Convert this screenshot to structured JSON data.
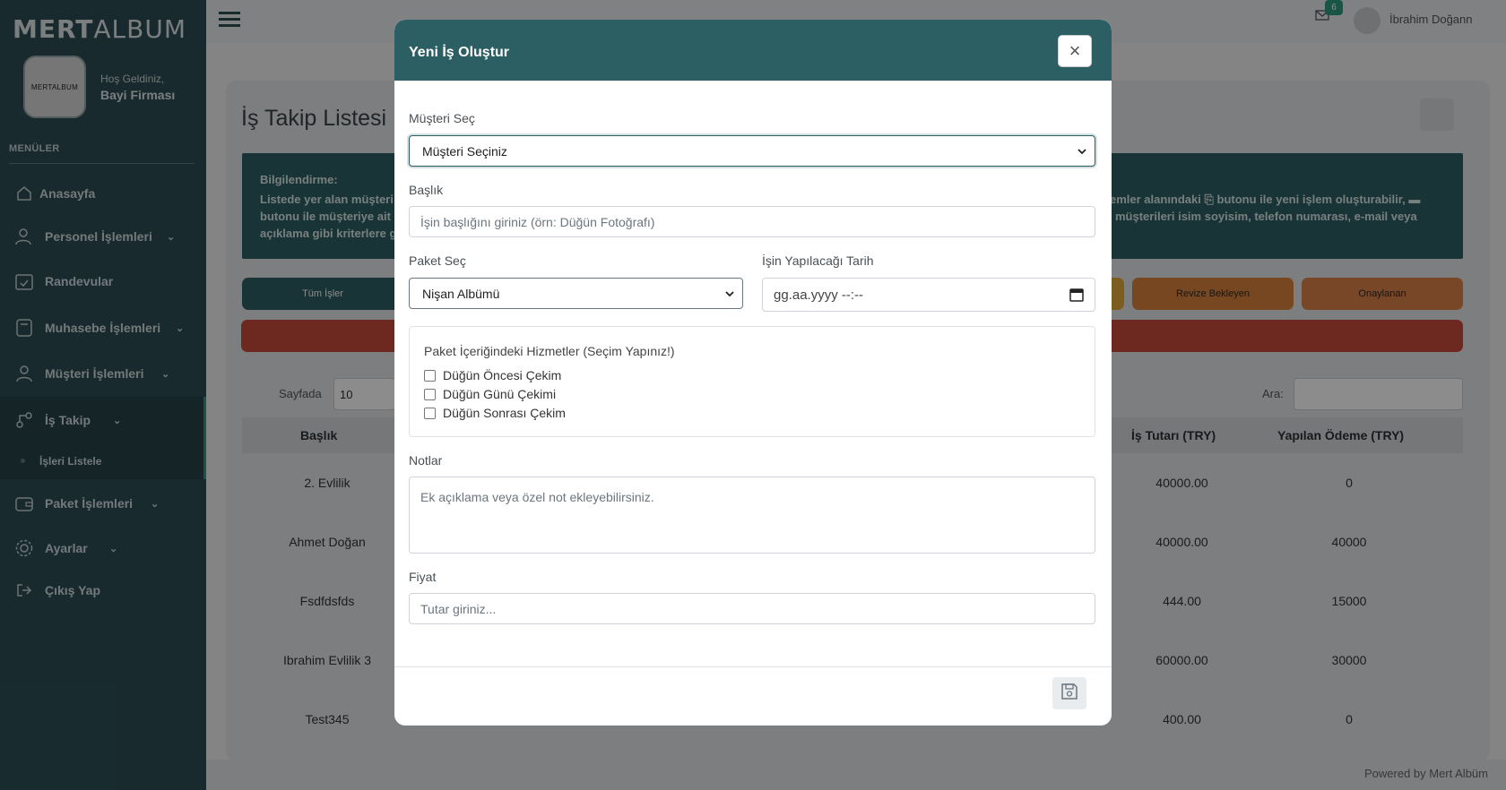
{
  "sidebar": {
    "logo_bold": "MERT",
    "logo_light": "ALBUM",
    "avatar_logo": "MERTALBUM",
    "welcome": "Hoş Geldiniz,",
    "firm": "Bayi Firması",
    "menus_title": "MENÜLER",
    "items": [
      {
        "label": "Anasayfa",
        "icon": "home-icon"
      },
      {
        "label": "Personel İşlemleri",
        "icon": "user-gear-icon"
      },
      {
        "label": "Randevular",
        "icon": "calendar-check-icon"
      },
      {
        "label": "Muhasebe İşlemleri",
        "icon": "calculator-icon"
      },
      {
        "label": "Müşteri İşlemleri",
        "icon": "user-icon"
      },
      {
        "label": "İş Takip",
        "icon": "tracking-icon"
      },
      {
        "label": "İşleri Listele",
        "icon": "dot-icon"
      },
      {
        "label": "Paket İşlemleri",
        "icon": "wallet-icon"
      },
      {
        "label": "Ayarlar",
        "icon": "gear-icon"
      },
      {
        "label": "Çıkış Yap",
        "icon": "logout-icon"
      }
    ]
  },
  "topbar": {
    "mail_badge": "6",
    "user_name": "İbrahim Doğann"
  },
  "page": {
    "title": "İş Takip Listesi",
    "info_title": "Bilgilendirme:",
    "info_left_1": "Listede yer alan müşteri",
    "info_left_2": "butonu ile müşteriye ait",
    "info_left_3": "açıklama gibi kriterlere g",
    "info_right_1": "emler alanındaki ⎘ butonu ile yeni işlem oluşturabilir, ▬",
    "info_right_2": "müşterileri isim soyisim, telefon numarası, e-mail veya",
    "filters": [
      "Tüm İşler",
      "Revize Bekleyen",
      "Onaylanan"
    ],
    "per_page_label": "Sayfada",
    "per_page_value": "10",
    "search_label": "Ara:",
    "col_title": "Başlık",
    "col_amount": "İş Tutarı (TRY)",
    "col_paid": "Yapılan Ödeme (TRY)",
    "rows": [
      {
        "title": "2. Evlilik",
        "amount": "40000.00",
        "paid": "0"
      },
      {
        "title": "Ahmet Doğan",
        "amount": "40000.00",
        "paid": "40000"
      },
      {
        "title": "Fsdfdsfds",
        "amount": "444.00",
        "paid": "15000"
      },
      {
        "title": "Ibrahim Evlilik 3",
        "amount": "60000.00",
        "paid": "30000"
      },
      {
        "title": "Test345",
        "amount": "400.00",
        "paid": "0"
      }
    ],
    "footer": "Powered by Mert Albüm"
  },
  "modal": {
    "title": "Yeni İş Oluştur",
    "customer_label": "Müşteri Seç",
    "customer_value": "Müşteri Seçiniz",
    "title_label": "Başlık",
    "title_placeholder": "İşin başlığını giriniz (örn: Düğün Fotoğrafı)",
    "package_label": "Paket Seç",
    "package_value": "Nişan Albümü",
    "date_label": "İşin Yapılacağı Tarih",
    "date_placeholder": "gg.aa.yyyy --:--",
    "services_title": "Paket İçeriğindeki Hizmetler (Seçim Yapınız!)",
    "services": [
      "Düğün Öncesi Çekim",
      "Düğün Günü Çekimi",
      "Düğün Sonrası Çekim"
    ],
    "notes_label": "Notlar",
    "notes_placeholder": "Ek açıklama veya özel not ekleyebilirsiniz.",
    "price_label": "Fiyat",
    "price_placeholder": "Tutar giriniz..."
  },
  "colors": {
    "sidebar": "#2c4e55",
    "modal_header": "#2c5f63",
    "accent": "#2f9c7e",
    "danger": "#c64a3b",
    "warning": "#d9823c"
  }
}
